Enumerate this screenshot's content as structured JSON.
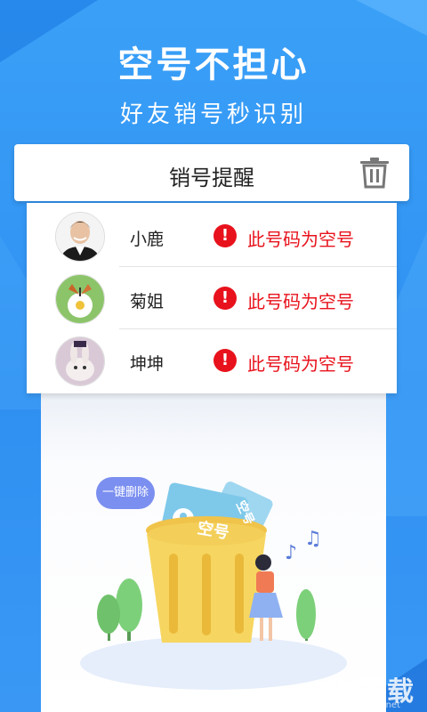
{
  "headline": "空号不担心",
  "subline": "好友销号秒识别",
  "header": {
    "title": "销号提醒",
    "trash_icon": "trash-icon"
  },
  "contacts": [
    {
      "name": "小鹿",
      "status": "此号码为空号",
      "avatar": "man-photo"
    },
    {
      "name": "菊姐",
      "status": "此号码为空号",
      "avatar": "butterfly-flower-photo"
    },
    {
      "name": "坤坤",
      "status": "此号码为空号",
      "avatar": "rabbit-photo"
    }
  ],
  "illustration": {
    "bubble_text": "一键删除",
    "card_front_text": "空号",
    "card_back_text": "空号"
  },
  "watermark": {
    "text": "KK下载",
    "url": "www.kkx.net"
  },
  "colors": {
    "accent": "#2f90f2",
    "warning": "#e8121c",
    "bubble": "#7b8ff0"
  }
}
